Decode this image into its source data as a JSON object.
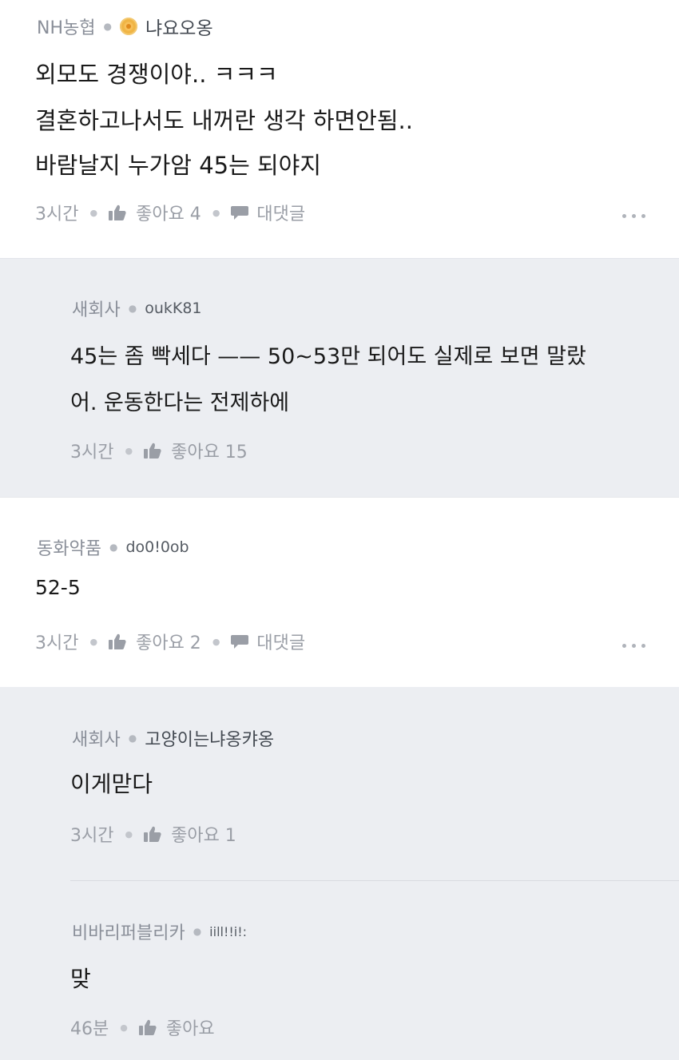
{
  "comments": [
    {
      "company": "NH농협",
      "nickname": "냐요오옹",
      "lines": [
        "외모도 경쟁이야.. ㅋㅋㅋ",
        "결혼하고나서도 내꺼란 생각 하면안됨..",
        "바람날지 누가암 45는 되야지"
      ],
      "time": "3시간",
      "like_label": "좋아요 4",
      "reply_label": "대댓글"
    },
    {
      "company": "새회사",
      "nickname": "oukK81",
      "lines": [
        "45는 좀 빡세다 —— 50~53만 되어도 실제로 보면 말랐",
        "어. 운동한다는 전제하에"
      ],
      "time": "3시간",
      "like_label": "좋아요 15"
    },
    {
      "company": "동화약품",
      "nickname": "do0!0ob",
      "lines": [
        "52-5"
      ],
      "time": "3시간",
      "like_label": "좋아요 2",
      "reply_label": "대댓글"
    },
    {
      "company": "새회사",
      "nickname": "고양이는냐옹캬옹",
      "lines": [
        "이게맏다"
      ],
      "time": "3시간",
      "like_label": "좋아요 1"
    },
    {
      "company": "비바리퍼블리카",
      "nickname": "iill!!i!:",
      "lines": [
        "맞"
      ],
      "time": "46분",
      "like_label": "좋아요"
    }
  ],
  "colors": {
    "reply_background": "#eceef2",
    "muted_text": "#9a9ea6",
    "medal": "#f0b545"
  },
  "icons": {
    "like": "thumbs-up-icon",
    "reply": "speech-bubble-icon",
    "badge": "medal-icon",
    "more": "more-dots-icon"
  }
}
